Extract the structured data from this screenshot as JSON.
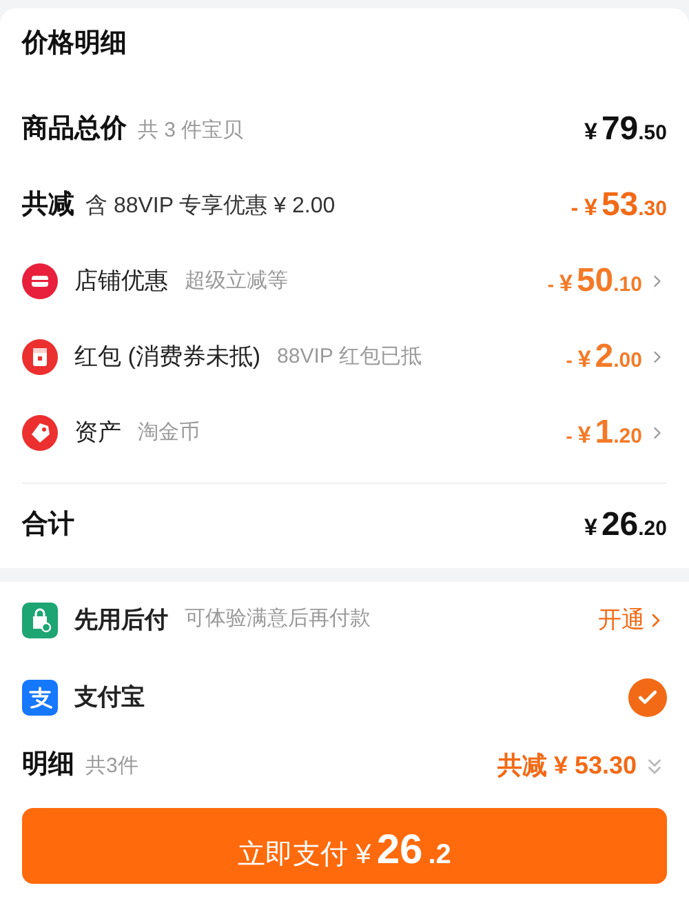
{
  "title": "价格明细",
  "subtotal": {
    "label": "商品总价",
    "note": "共 3 件宝贝",
    "price": {
      "currency": "¥",
      "integer": "79",
      "decimal": ".50"
    }
  },
  "reduction": {
    "label": "共减",
    "note": "含 88VIP 专享优惠 ¥ 2.00",
    "price": {
      "sign": "- ",
      "currency": "¥",
      "integer": "53",
      "decimal": ".30"
    }
  },
  "discounts": [
    {
      "kind": "shop",
      "label": "店铺优惠",
      "note": "超级立减等",
      "price": {
        "sign": "- ",
        "currency": "¥",
        "integer": "50",
        "decimal": ".10"
      }
    },
    {
      "kind": "redpacket",
      "label": "红包 (消费券未抵)",
      "note": "88VIP 红包已抵",
      "price": {
        "sign": "- ",
        "currency": "¥",
        "integer": "2",
        "decimal": ".00"
      }
    },
    {
      "kind": "tag",
      "label": "资产",
      "note": "淘金币",
      "price": {
        "sign": "- ",
        "currency": "¥",
        "integer": "1",
        "decimal": ".20"
      }
    }
  ],
  "total": {
    "label": "合计",
    "price": {
      "currency": "¥",
      "integer": "26",
      "decimal": ".20"
    }
  },
  "payment_methods": [
    {
      "kind": "activate",
      "label": "先用后付",
      "note": "可体验满意后再付款",
      "action": "开通"
    },
    {
      "kind": "radio",
      "label": "支付宝",
      "selected": true
    }
  ],
  "details": {
    "label": "明细",
    "note": "共3件",
    "summary": "共减 ¥ 53.30"
  },
  "pay_button": {
    "label": "立即支付 ¥",
    "integer": "26",
    "decimal": ".2"
  }
}
